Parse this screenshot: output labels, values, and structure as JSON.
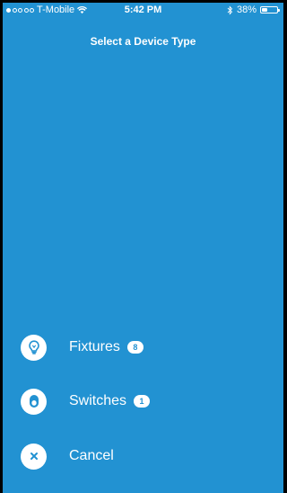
{
  "status_bar": {
    "carrier": "T-Mobile",
    "time": "5:42 PM",
    "battery": "38%",
    "battery_level": 0.38,
    "icons": [
      "signal-dots-icon",
      "wifi-icon",
      "bluetooth-icon",
      "battery-icon"
    ]
  },
  "header": {
    "title": "Select a Device Type"
  },
  "options": [
    {
      "label": "Fixtures",
      "count": "8",
      "icon": "lightbulb-icon"
    },
    {
      "label": "Switches",
      "count": "1",
      "icon": "switch-toggle-icon"
    },
    {
      "label": "Cancel",
      "icon": "close-icon"
    }
  ],
  "colors": {
    "background": "#2292d2",
    "foreground": "#ffffff"
  }
}
